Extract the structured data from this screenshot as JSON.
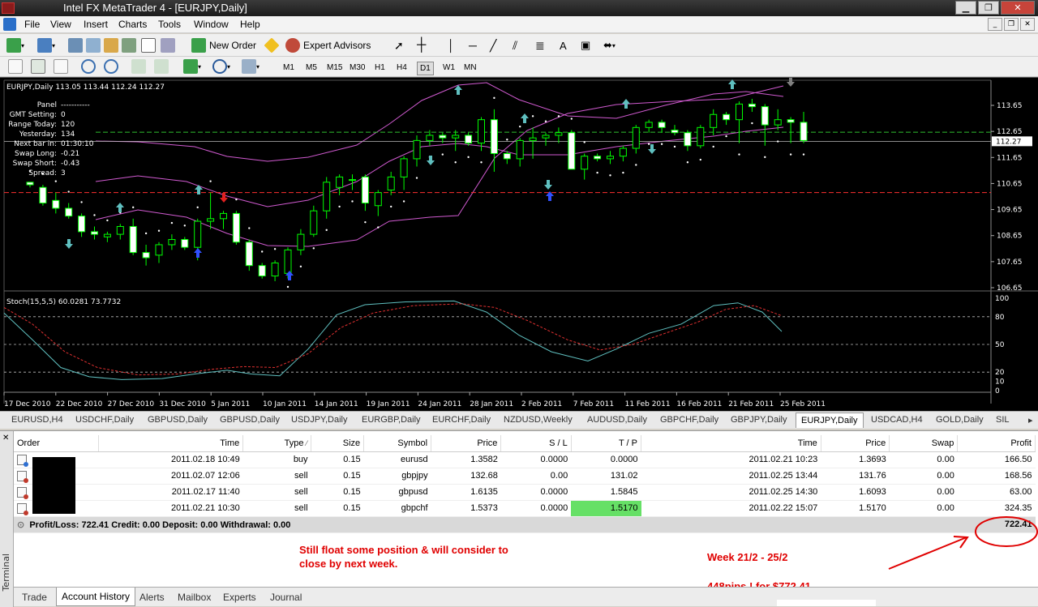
{
  "window": {
    "title": "Intel FX MetaTrader 4 - [EURJPY,Daily]"
  },
  "menu": [
    "File",
    "View",
    "Insert",
    "Charts",
    "Tools",
    "Window",
    "Help"
  ],
  "toolbar": {
    "new_order": "New Order",
    "expert_advisors": "Expert Advisors"
  },
  "timeframes": [
    "M1",
    "M5",
    "M15",
    "M30",
    "H1",
    "H4",
    "D1",
    "W1",
    "MN"
  ],
  "active_timeframe": "D1",
  "chart": {
    "header": "EURJPY,Daily  113.05 113.44 112.24 112.27",
    "panel": [
      [
        "Panel",
        "-----------"
      ],
      [
        "GMT Setting:",
        "0"
      ],
      [
        "Range Today:",
        "120"
      ],
      [
        "Yesterday:",
        "134"
      ],
      [
        "Next bar in:",
        "01:30:10"
      ],
      [
        "Swap Long:",
        "-0.21"
      ],
      [
        "Swap Short:",
        "-0.43"
      ],
      [
        "Spread:",
        "3"
      ]
    ],
    "price_axis": [
      "113.65",
      "112.65",
      "111.65",
      "110.65",
      "109.65",
      "108.65",
      "107.65",
      "106.65"
    ],
    "current_price": "112.27",
    "stoch_header": "Stoch(15,5,5) 60.0281 73.7732",
    "stoch_axis": [
      "100",
      "80",
      "50",
      "20",
      "10",
      "0"
    ],
    "date_axis": [
      "17 Dec 2010",
      "22 Dec 2010",
      "27 Dec 2010",
      "31 Dec 2010",
      "5 Jan 2011",
      "10 Jan 2011",
      "14 Jan 2011",
      "19 Jan 2011",
      "24 Jan 2011",
      "28 Jan 2011",
      "2 Feb 2011",
      "7 Feb 2011",
      "11 Feb 2011",
      "16 Feb 2011",
      "21 Feb 2011",
      "25 Feb 2011"
    ],
    "colors": {
      "bull": "#00ff00",
      "bear_fill": "#ffffff",
      "bands": "#d05ad0",
      "sar": "#ffffff",
      "level": "#ff3030",
      "stoch_main": "#5fbfbf",
      "stoch_signal": "#e03030"
    }
  },
  "symbol_tabs": [
    "EURUSD,H4",
    "USDCHF,Daily",
    "GBPUSD,Daily",
    "GBPUSD,Daily",
    "USDJPY,Daily",
    "EURGBP,Daily",
    "EURCHF,Daily",
    "NZDUSD,Weekly",
    "AUDUSD,Daily",
    "GBPCHF,Daily",
    "GBPJPY,Daily",
    "EURJPY,Daily",
    "USDCAD,H4",
    "GOLD,Daily",
    "SIL"
  ],
  "active_symbol_tab": "EURJPY,Daily",
  "history": {
    "columns": [
      "Order",
      "Time",
      "Type",
      "Size",
      "Symbol",
      "Price",
      "S / L",
      "T / P",
      "Time",
      "Price",
      "Swap",
      "Profit"
    ],
    "rows": [
      {
        "open_time": "2011.02.18 10:49",
        "type": "buy",
        "size": "0.15",
        "symbol": "eurusd",
        "price": "1.3582",
        "sl": "0.0000",
        "tp": "0.0000",
        "close_time": "2011.02.21 10:23",
        "close_price": "1.3693",
        "swap": "0.00",
        "profit": "166.50"
      },
      {
        "open_time": "2011.02.07 12:06",
        "type": "sell",
        "size": "0.15",
        "symbol": "gbpjpy",
        "price": "132.68",
        "sl": "0.00",
        "tp": "131.02",
        "close_time": "2011.02.25 13:44",
        "close_price": "131.76",
        "swap": "0.00",
        "profit": "168.56"
      },
      {
        "open_time": "2011.02.17 11:40",
        "type": "sell",
        "size": "0.15",
        "symbol": "gbpusd",
        "price": "1.6135",
        "sl": "0.0000",
        "tp": "1.5845",
        "close_time": "2011.02.25 14:30",
        "close_price": "1.6093",
        "swap": "0.00",
        "profit": "63.00"
      },
      {
        "open_time": "2011.02.21 10:30",
        "type": "sell",
        "size": "0.15",
        "symbol": "gbpchf",
        "price": "1.5373",
        "sl": "0.0000",
        "tp": "1.5170",
        "close_time": "2011.02.22 15:07",
        "close_price": "1.5170",
        "swap": "0.00",
        "profit": "324.35"
      }
    ],
    "summary": "Profit/Loss: 722.41   Credit: 0.00   Deposit: 0.00   Withdrawal: 0.00",
    "total": "722.41"
  },
  "notes": {
    "float": "Still float some position & will consider to close by next week.",
    "week": "Week 21/2 - 25/2",
    "pips": "448pips ! for $772.41"
  },
  "terminal_label": "Terminal",
  "bottom_tabs": [
    "Trade",
    "Account History",
    "Alerts",
    "Mailbox",
    "Experts",
    "Journal"
  ],
  "active_bottom_tab": "Account History"
}
